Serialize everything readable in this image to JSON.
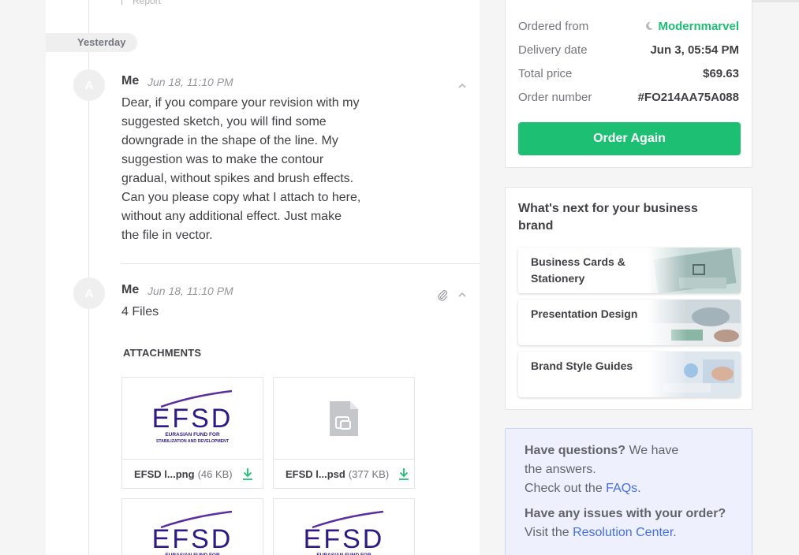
{
  "feed": {
    "report_label": "Report",
    "day_label": "Yesterday",
    "message1": {
      "avatar": "A",
      "name": "Me",
      "time": "Jun 18, 11:10 PM",
      "lines": [
        "Dear, if you compare your revision with my",
        "suggested sketch, you will find some",
        "downgrade in the shape of the line. My",
        "suggestion was to make the contour",
        "gradual, without spikes and brush effects.",
        "Can you please copy what I attach to here,",
        "without any additional effect. Just make",
        "the file in vector."
      ]
    },
    "message2": {
      "avatar": "A",
      "name": "Me",
      "time": "Jun 18, 11:10 PM",
      "files_count": "4 Files",
      "attachments_title": "ATTACHMENTS",
      "attachments": [
        {
          "name": "EFSD l...png",
          "size": "(46 KB)",
          "kind": "efsd-logo"
        },
        {
          "name": "EFSD l...psd",
          "size": "(377 KB)",
          "kind": "generic-file"
        },
        {
          "name": "",
          "size": "",
          "kind": "efsd-logo"
        },
        {
          "name": "",
          "size": "",
          "kind": "efsd-logo"
        }
      ]
    },
    "logo": {
      "mark": "EFSD",
      "sub1": "EURASIAN FUND FOR",
      "sub2": "STABILIZATION AND DEVELOPMENT",
      "color": "#2e1a86",
      "swoosh": "#5a2da0"
    }
  },
  "order": {
    "rows": [
      {
        "key": "Ordered from",
        "value": "Modernmarvel"
      },
      {
        "key": "Delivery date",
        "value": "Jun 3, 05:54 PM"
      },
      {
        "key": "Total price",
        "value": "$69.63"
      },
      {
        "key": "Order number",
        "value": "#FO214AA75A088"
      }
    ],
    "button": "Order Again",
    "accent": "#1dbf73"
  },
  "next": {
    "title": "What's next for your business brand",
    "services": [
      {
        "label": "Business Cards & Stationery"
      },
      {
        "label": "Presentation Design"
      },
      {
        "label": "Brand Style Guides"
      }
    ]
  },
  "help": {
    "q1_bold": "Have questions?",
    "q1_rest": " We have",
    "q1_line2": "the answers.",
    "q1_line3_pre": "Check out the ",
    "q1_link": "FAQs",
    "q1_line3_post": ".",
    "q2_bold": "Have any issues with your order?",
    "q2_pre": "Visit the ",
    "q2_link": "Resolution Center",
    "q2_post": "."
  }
}
